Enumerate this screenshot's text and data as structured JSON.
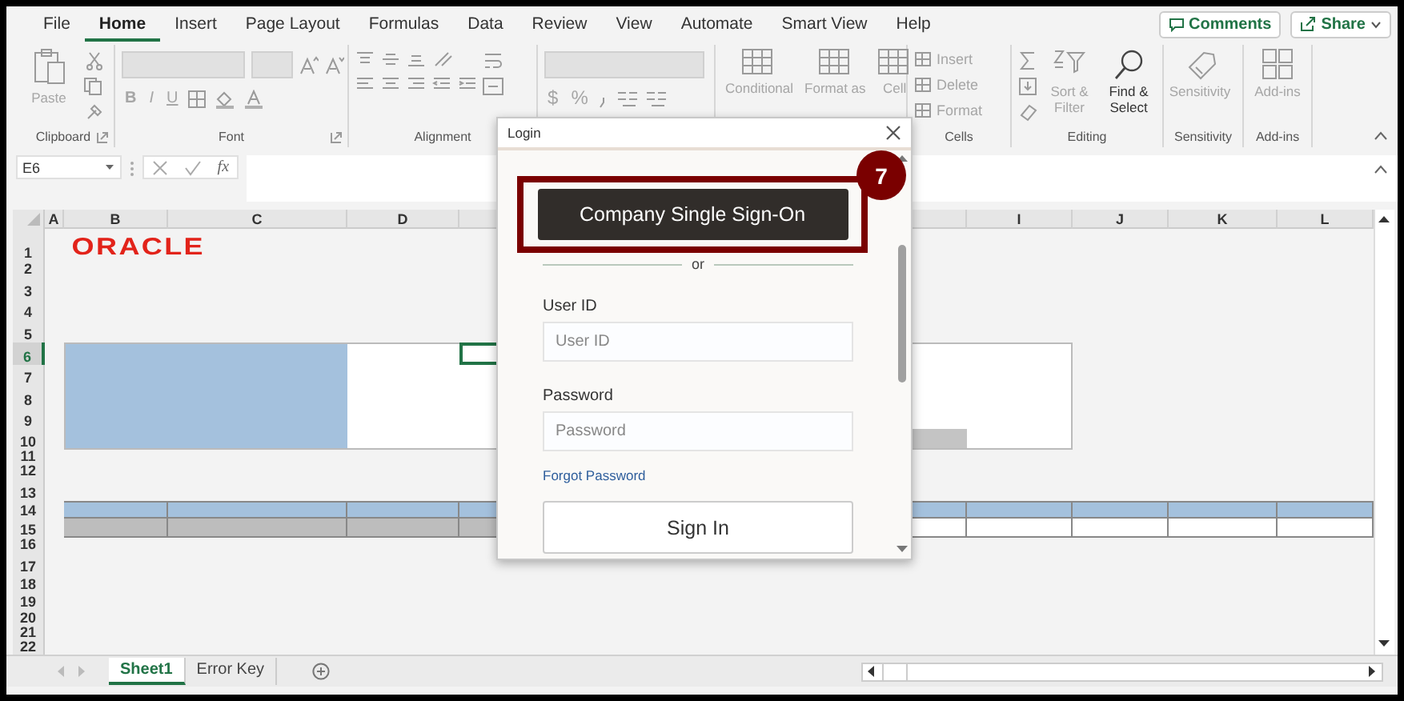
{
  "menu_tabs": [
    {
      "label": "File",
      "selected": false
    },
    {
      "label": "Home",
      "selected": true
    },
    {
      "label": "Insert",
      "selected": false
    },
    {
      "label": "Page Layout",
      "selected": false
    },
    {
      "label": "Formulas",
      "selected": false
    },
    {
      "label": "Data",
      "selected": false
    },
    {
      "label": "Review",
      "selected": false
    },
    {
      "label": "View",
      "selected": false
    },
    {
      "label": "Automate",
      "selected": false
    },
    {
      "label": "Smart View",
      "selected": false
    },
    {
      "label": "Help",
      "selected": false
    }
  ],
  "actions": [
    {
      "kind": "comments",
      "label": "Comments"
    },
    {
      "kind": "share",
      "label": "Share"
    }
  ],
  "ribbon": {
    "groups": [
      {
        "kind": "clipboard",
        "label": "Clipboard",
        "buttons": [
          {
            "label": "Paste",
            "disabled": true
          }
        ]
      },
      {
        "kind": "font",
        "label": "Font",
        "buttons": [
          {
            "label": "B",
            "disabled": true
          },
          {
            "label": "I",
            "disabled": true
          },
          {
            "label": "U",
            "disabled": true
          }
        ]
      },
      {
        "kind": "alignment",
        "label": "Alignment"
      },
      {
        "kind": "number",
        "buttons": [
          {
            "label": "$",
            "disabled": true
          },
          {
            "label": "%",
            "disabled": true
          }
        ]
      },
      {
        "kind": "styles",
        "buttons": [
          {
            "label": "Conditional",
            "disabled": true
          },
          {
            "label": "Format as",
            "disabled": true
          },
          {
            "label": "Cell",
            "disabled": true
          }
        ]
      },
      {
        "kind": "cells",
        "label": "Cells",
        "buttons": [
          {
            "label": "Insert",
            "disabled": true
          },
          {
            "label": "Delete",
            "disabled": true
          },
          {
            "label": "Format",
            "disabled": true
          }
        ]
      },
      {
        "kind": "editing",
        "label": "Editing",
        "buttons": [
          {
            "label": "Sort & Filter",
            "disabled": true
          },
          {
            "label": "Find & Select",
            "disabled": false
          }
        ]
      },
      {
        "kind": "sensitivity",
        "label": "Sensitivity",
        "buttons": [
          {
            "label": "Sensitivity",
            "disabled": true
          }
        ]
      },
      {
        "kind": "addins",
        "label": "Add-ins",
        "buttons": [
          {
            "label": "Add-ins",
            "disabled": true
          }
        ]
      }
    ]
  },
  "formula_bar": {
    "name_box": "E6",
    "function_label": "fx"
  },
  "sheet": {
    "logo": "ORACLE",
    "columns": [
      {
        "label": "A"
      },
      {
        "label": "B"
      },
      {
        "label": "C"
      },
      {
        "label": "D"
      },
      {
        "label": "I"
      },
      {
        "label": "J"
      },
      {
        "label": "K"
      },
      {
        "label": "L"
      }
    ],
    "rows": [
      {
        "label": "1",
        "selected": false
      },
      {
        "label": "2",
        "selected": false
      },
      {
        "label": "3",
        "selected": false
      },
      {
        "label": "4",
        "selected": false
      },
      {
        "label": "5",
        "selected": false
      },
      {
        "label": "6",
        "selected": true
      },
      {
        "label": "7",
        "selected": false
      },
      {
        "label": "8",
        "selected": false
      },
      {
        "label": "9",
        "selected": false
      },
      {
        "label": "10",
        "selected": false
      },
      {
        "label": "11",
        "selected": false
      },
      {
        "label": "12",
        "selected": false
      },
      {
        "label": "13",
        "selected": false
      },
      {
        "label": "14",
        "selected": false
      },
      {
        "label": "15",
        "selected": false
      },
      {
        "label": "16",
        "selected": false
      },
      {
        "label": "17",
        "selected": false
      },
      {
        "label": "18",
        "selected": false
      },
      {
        "label": "19",
        "selected": false
      },
      {
        "label": "20",
        "selected": false
      },
      {
        "label": "21",
        "selected": false
      },
      {
        "label": "22",
        "selected": false
      }
    ]
  },
  "sheet_tabs": [
    {
      "label": "Sheet1",
      "selected": true
    },
    {
      "label": "Error Key",
      "selected": false
    }
  ],
  "dialog": {
    "title": "Login",
    "sso_button": "Company Single Sign-On",
    "step_badge": "7",
    "divider_text": "or",
    "fields": [
      {
        "label": "User ID",
        "placeholder": "User ID"
      },
      {
        "label": "Password",
        "placeholder": "Password"
      }
    ],
    "forgot_link": "Forgot Password",
    "submit_button": "Sign In"
  }
}
